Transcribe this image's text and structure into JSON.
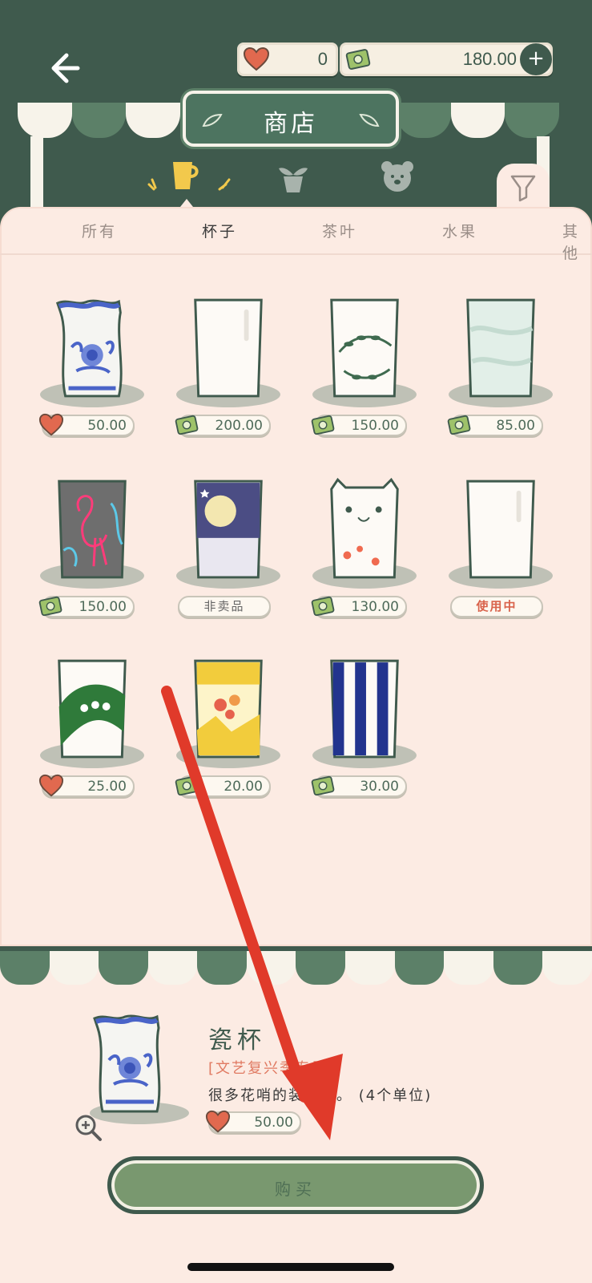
{
  "header": {
    "title": "商店",
    "hearts": "0",
    "money": "180.00",
    "plus_label": "+"
  },
  "categories": [
    "cup-icon",
    "plant-icon",
    "bear-icon"
  ],
  "tabs": [
    "所有",
    "杯子",
    "茶叶",
    "水果",
    "其他"
  ],
  "active_tab": "杯子",
  "items": [
    {
      "name": "瓷杯",
      "currency": "heart",
      "price": "50.00"
    },
    {
      "name": "plain-glass",
      "currency": "money",
      "price": "200.00"
    },
    {
      "name": "leaf-glass",
      "currency": "money",
      "price": "150.00"
    },
    {
      "name": "marble-glass",
      "currency": "money",
      "price": "85.00"
    },
    {
      "name": "flamingo-glass",
      "currency": "money",
      "price": "150.00"
    },
    {
      "name": "moon-glass",
      "status": "非卖品"
    },
    {
      "name": "cat-glass",
      "currency": "money",
      "price": "130.00"
    },
    {
      "name": "default-glass",
      "status": "使用中"
    },
    {
      "name": "lily-glass",
      "currency": "heart",
      "price": "25.00"
    },
    {
      "name": "yellow-flower-glass",
      "currency": "money",
      "price": "20.00"
    },
    {
      "name": "blue-dot-glass",
      "currency": "money",
      "price": "30.00"
    }
  ],
  "detail": {
    "name": "瓷杯",
    "season": "[文艺复兴季专属]",
    "description": "很多花哨的装饰品。 (4个单位)",
    "price": "50.00",
    "buy_label": "购买"
  },
  "colors": {
    "dark_green": "#3f5a4d",
    "panel_bg": "#fcebe3",
    "accent_red": "#e03a2a"
  }
}
